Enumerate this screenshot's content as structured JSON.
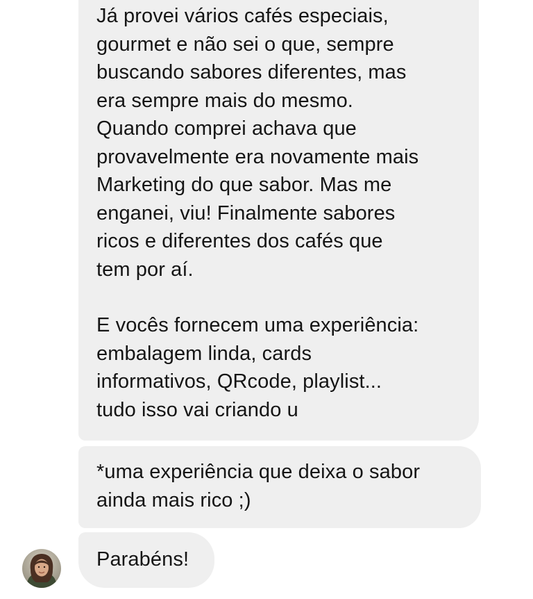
{
  "chat": {
    "messages": [
      {
        "sender": "contact",
        "paragraphs": [
          "Já provei vários cafés especiais,\ngourmet e não sei o que, sempre\nbuscando sabores diferentes, mas\nera sempre mais do mesmo.\nQuando comprei achava que\nprovavelmente era novamente mais\nMarketing do que sabor. Mas me\nenganei, viu! Finalmente sabores\nricos e diferentes dos cafés que\ntem por aí.",
          "E vocês fornecem uma experiência:\nembalagem linda, cards\ninformativos, QRcode, playlist...\ntudo isso vai criando u"
        ]
      },
      {
        "sender": "contact",
        "text": "*uma experiência que deixa o sabor\nainda mais rico ;)"
      },
      {
        "sender": "contact",
        "text": "Parabéns!"
      }
    ],
    "avatar_icon": "user-avatar-photo",
    "colors": {
      "bubble_background": "#efefef",
      "page_background": "#ffffff",
      "text": "#151515"
    }
  }
}
